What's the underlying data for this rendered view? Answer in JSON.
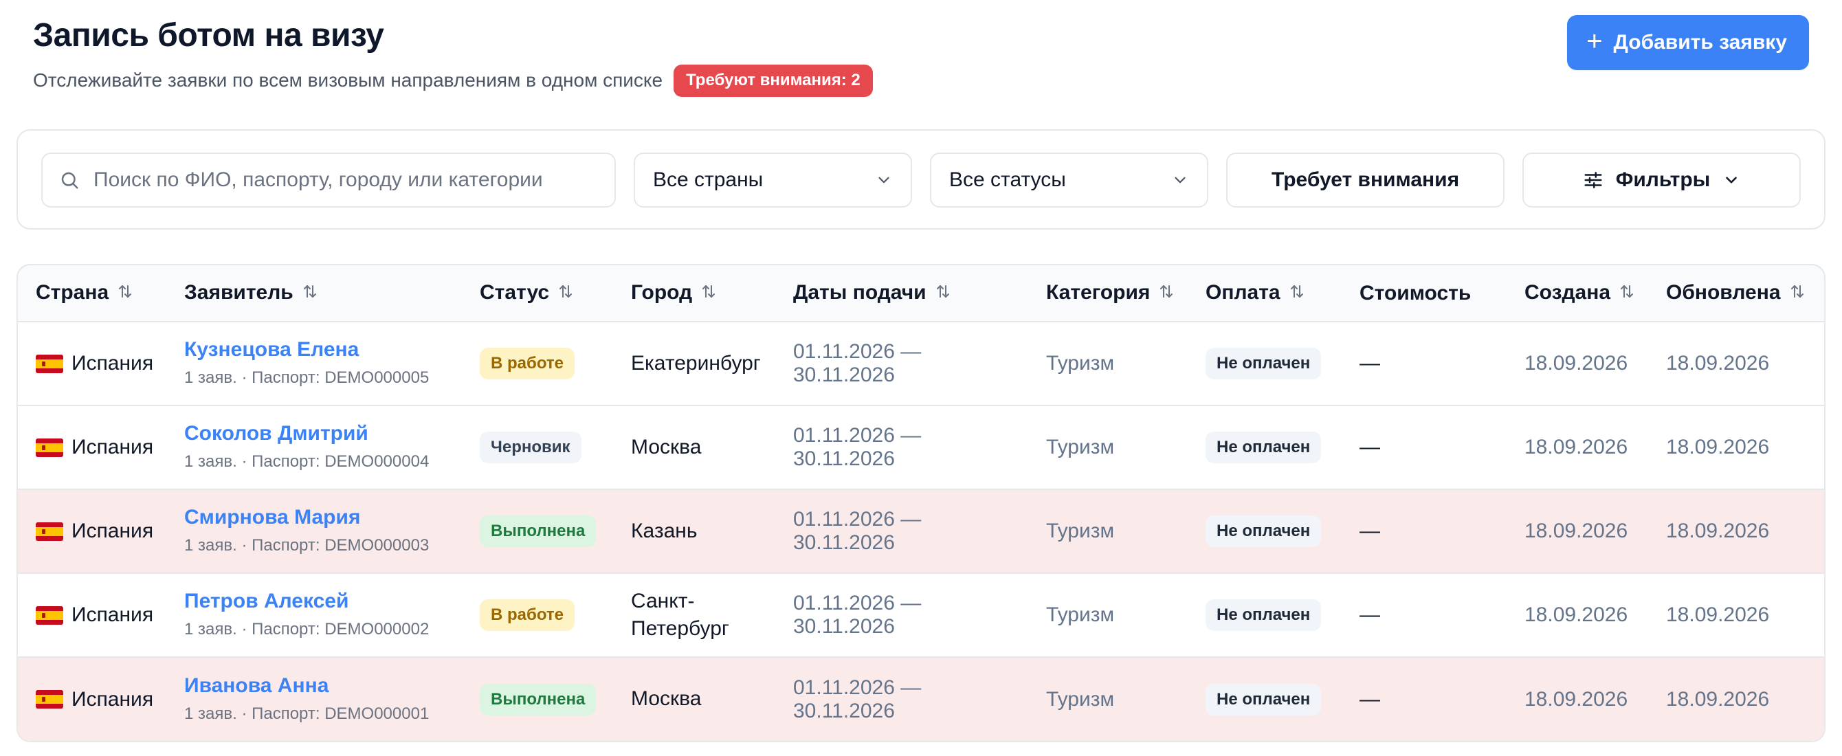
{
  "header": {
    "title": "Запись ботом на визу",
    "subtitle": "Отслеживайте заявки по всем визовым направлениям в одном списке",
    "attention_badge": "Требуют внимания: 2",
    "add_button": "Добавить заявку"
  },
  "filters": {
    "search_placeholder": "Поиск по ФИО, паспорту, городу или категории",
    "country_select": "Все страны",
    "status_select": "Все статусы",
    "attention_button": "Требует внимания",
    "filters_button": "Фильтры"
  },
  "table": {
    "columns": [
      "Страна",
      "Заявитель",
      "Статус",
      "Город",
      "Даты подачи",
      "Категория",
      "Оплата",
      "Стоимость",
      "Создана",
      "Обновлена"
    ],
    "rows": [
      {
        "country": "Испания",
        "name": "Кузнецова Елена",
        "meta": "1 заяв. · Паспорт: DEMO000005",
        "status": "В работе",
        "status_kind": "work",
        "city": "Екатеринбург",
        "dates": "01.11.2026 — 30.11.2026",
        "category": "Туризм",
        "payment": "Не оплачен",
        "cost": "—",
        "created": "18.09.2026",
        "updated": "18.09.2026",
        "attention": false
      },
      {
        "country": "Испания",
        "name": "Соколов Дмитрий",
        "meta": "1 заяв. · Паспорт: DEMO000004",
        "status": "Черновик",
        "status_kind": "draft",
        "city": "Москва",
        "dates": "01.11.2026 — 30.11.2026",
        "category": "Туризм",
        "payment": "Не оплачен",
        "cost": "—",
        "created": "18.09.2026",
        "updated": "18.09.2026",
        "attention": false
      },
      {
        "country": "Испания",
        "name": "Смирнова Мария",
        "meta": "1 заяв. · Паспорт: DEMO000003",
        "status": "Выполнена",
        "status_kind": "done",
        "city": "Казань",
        "dates": "01.11.2026 — 30.11.2026",
        "category": "Туризм",
        "payment": "Не оплачен",
        "cost": "—",
        "created": "18.09.2026",
        "updated": "18.09.2026",
        "attention": true
      },
      {
        "country": "Испания",
        "name": "Петров Алексей",
        "meta": "1 заяв. · Паспорт: DEMO000002",
        "status": "В работе",
        "status_kind": "work",
        "city": "Санкт-Петербург",
        "dates": "01.11.2026 — 30.11.2026",
        "category": "Туризм",
        "payment": "Не оплачен",
        "cost": "—",
        "created": "18.09.2026",
        "updated": "18.09.2026",
        "attention": false
      },
      {
        "country": "Испания",
        "name": "Иванова Анна",
        "meta": "1 заяв. · Паспорт: DEMO000001",
        "status": "Выполнена",
        "status_kind": "done",
        "city": "Москва",
        "dates": "01.11.2026 — 30.11.2026",
        "category": "Туризм",
        "payment": "Не оплачен",
        "cost": "—",
        "created": "18.09.2026",
        "updated": "18.09.2026",
        "attention": true
      }
    ]
  },
  "icons": {
    "search": "search-icon",
    "chevron": "chevron-down-icon",
    "sort": "sort-icon",
    "sliders": "sliders-icon",
    "plus": "plus-icon",
    "flag": "spain-flag-icon"
  },
  "colors": {
    "primary": "#3b82f6",
    "attention_badge": "#e5484d",
    "attention_row": "#fbeaea",
    "status_work_bg": "#fdf3c4",
    "status_draft_bg": "#f1f5f9",
    "status_done_bg": "#dcf5e3"
  }
}
